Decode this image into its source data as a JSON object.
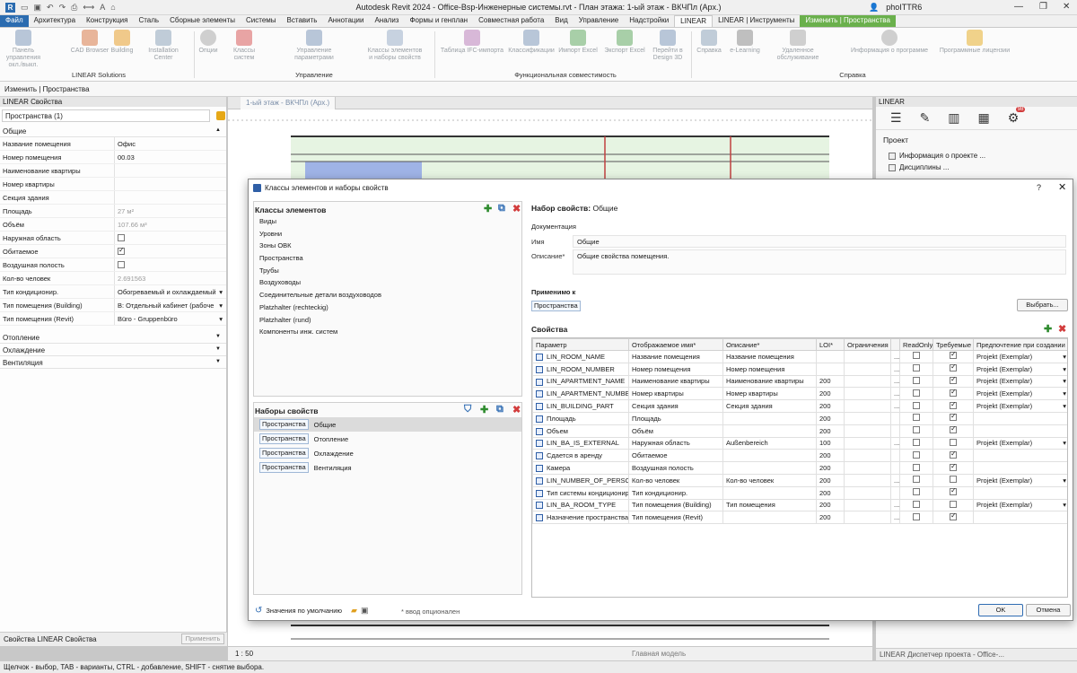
{
  "titlebar": {
    "title": "Autodesk Revit 2024 - Office-Bsp-Инженерные системы.rvt - План этажа: 1-ый этаж - ВКЧПл (Арх.)",
    "user": "phoITTR6",
    "minimize": "—",
    "restore": "❐",
    "close": "✕"
  },
  "menu": {
    "tabs": [
      "Файл",
      "Архитектура",
      "Конструкция",
      "Сталь",
      "Сборные элементы",
      "Системы",
      "Вставить",
      "Аннотации",
      "Анализ",
      "Формы и генплан",
      "Совместная работа",
      "Вид",
      "Управление",
      "Надстройки",
      "LINEAR",
      "LINEAR | Инструменты",
      "Изменить | Пространства"
    ]
  },
  "ribbon": {
    "buttons": [
      "Панель управления\nокл./выкл.",
      "CAD Browser",
      "Building",
      "Installation Center",
      "Опции",
      "Классы систем",
      "Управление параметрами",
      "Классы элементов\nи наборы свойств",
      "Таблица IFC-импорта",
      "Классификации",
      "Импорт Excel",
      "Экспорт Excel",
      "Перейти в\nDesign 3D",
      "Справка",
      "e-Learning",
      "Удаленное обслуживание",
      "Информация о программе",
      "Программные лицензии"
    ],
    "groups": [
      "LINEAR Solutions",
      "Управление",
      "Функциональная совместимость",
      "Справка"
    ]
  },
  "context_bar": "Изменить | Пространства",
  "properties": {
    "header": "LINEAR Свойства",
    "type_selector": "Пространства (1)",
    "sections": [
      "Общие",
      "Отопление",
      "Охлаждение",
      "Вентиляция"
    ],
    "rows": [
      {
        "k": "Название помещения",
        "v": "Офис"
      },
      {
        "k": "Номер помещения",
        "v": "00.03"
      },
      {
        "k": "Наименование квартиры",
        "v": ""
      },
      {
        "k": "Номер квартиры",
        "v": ""
      },
      {
        "k": "Секция здания",
        "v": ""
      },
      {
        "k": "Площадь",
        "v": "27 м²"
      },
      {
        "k": "Объём",
        "v": "107.66 м³"
      },
      {
        "k": "Наружная область",
        "v": ""
      },
      {
        "k": "Обитаемое",
        "v": ""
      },
      {
        "k": "Воздушная полость",
        "v": ""
      },
      {
        "k": "Кол-во человек",
        "v": "2.691563"
      },
      {
        "k": "Тип кондиционир.",
        "v": "Обогреваемый и охлаждаемый"
      },
      {
        "k": "Тип помещения (Building)",
        "v": "B: Отдельный кабинет (рабоче"
      },
      {
        "k": "Тип помещения (Revit)",
        "v": "Büro - Gruppenbüro"
      }
    ],
    "bottom_tabs": "Свойства    LINEAR Свойства",
    "apply": "Применить"
  },
  "view": {
    "tab": "1-ый этаж - ВКЧПл (Арх.)",
    "scale": "1 : 50",
    "model": "Главная модель"
  },
  "right_panel": {
    "header": "LINEAR",
    "badge": "98",
    "title": "Проект",
    "items": [
      "Информация о проекте ...",
      "Дисциплины ..."
    ],
    "bottom": "LINEAR    Диспетчер проекта - Office-..."
  },
  "status_bar": "Щелчок - выбор, TAB - варианты, CTRL - добавление, SHIFT - снятие выбора.",
  "dialog": {
    "title": "Классы элементов и наборы свойств",
    "help": "?",
    "close": "✕",
    "classes_title": "Классы элементов",
    "classes": [
      "Виды",
      "Уровни",
      "Зоны ОВК",
      "Пространства",
      "Трубы",
      "Воздуховоды",
      "Соединительные детали воздуховодов",
      "Platzhalter (rechteckig)",
      "Platzhalter (rund)",
      "Компоненты инж. систем"
    ],
    "sets_title": "Наборы свойств",
    "sets": [
      {
        "tag": "Пространства",
        "name": "Общие"
      },
      {
        "tag": "Пространства",
        "name": "Отопление"
      },
      {
        "tag": "Пространства",
        "name": "Охлаждение"
      },
      {
        "tag": "Пространства",
        "name": "Вентиляция"
      }
    ],
    "defaults": "Значения по умолчанию",
    "optional_note": "* ввод опционален",
    "set_label": "Набор свойств:",
    "set_name": "Общие",
    "doc_title": "Документация",
    "name_label": "Имя",
    "name_value": "Общие",
    "desc_label": "Описание*",
    "desc_value": "Общие свойства помещения.",
    "applies_title": "Применимо к",
    "applies_tag": "Пространства",
    "select_btn": "Выбрать...",
    "props_title": "Свойства",
    "columns": [
      "Параметр",
      "Отображаемое имя*",
      "Описание*",
      "LOI*",
      "Ограничения",
      "",
      "ReadOnly",
      "Требуемые",
      "Предпочтение при создании"
    ],
    "rows": [
      {
        "p": "LIN_ROOM_NAME",
        "d": "Название помещения",
        "desc": "Название помещения",
        "loi": "",
        "dots": "...",
        "ro": false,
        "req": true,
        "pref": "Projekt (Exemplar)"
      },
      {
        "p": "LIN_ROOM_NUMBER",
        "d": "Номер помещения",
        "desc": "Номер помещения",
        "loi": "",
        "dots": "...",
        "ro": false,
        "req": true,
        "pref": "Projekt (Exemplar)"
      },
      {
        "p": "LIN_APARTMENT_NAME",
        "d": "Наименование квартиры",
        "desc": "Наименование квартиры",
        "loi": "200",
        "dots": "...",
        "ro": false,
        "req": true,
        "pref": "Projekt (Exemplar)"
      },
      {
        "p": "LIN_APARTMENT_NUMBER",
        "d": "Номер квартиры",
        "desc": "Номер квартиры",
        "loi": "200",
        "dots": "...",
        "ro": false,
        "req": true,
        "pref": "Projekt (Exemplar)"
      },
      {
        "p": "LIN_BUILDING_PART",
        "d": "Секция здания",
        "desc": "Секция здания",
        "loi": "200",
        "dots": "...",
        "ro": false,
        "req": true,
        "pref": "Projekt (Exemplar)"
      },
      {
        "p": "Площадь",
        "d": "Площадь",
        "desc": "",
        "loi": "200",
        "dots": "",
        "ro": false,
        "req": true,
        "pref": ""
      },
      {
        "p": "Объем",
        "d": "Объём",
        "desc": "",
        "loi": "200",
        "dots": "",
        "ro": false,
        "req": true,
        "pref": ""
      },
      {
        "p": "LIN_BA_IS_EXTERNAL",
        "d": "Наружная область",
        "desc": "Außenbereich",
        "loi": "100",
        "dots": "...",
        "ro": false,
        "req": false,
        "pref": "Projekt (Exemplar)"
      },
      {
        "p": "Сдается в аренду",
        "d": "Обитаемое",
        "desc": "",
        "loi": "200",
        "dots": "",
        "ro": false,
        "req": true,
        "pref": ""
      },
      {
        "p": "Камера",
        "d": "Воздушная полость",
        "desc": "",
        "loi": "200",
        "dots": "",
        "ro": false,
        "req": true,
        "pref": ""
      },
      {
        "p": "LIN_NUMBER_OF_PERSONS",
        "d": "Кол-во человек",
        "desc": "Кол-во человек",
        "loi": "200",
        "dots": "...",
        "ro": false,
        "req": false,
        "pref": "Projekt (Exemplar)"
      },
      {
        "p": "Тип системы кондиционир.",
        "d": "Тип кондиционир.",
        "desc": "",
        "loi": "200",
        "dots": "",
        "ro": false,
        "req": true,
        "pref": ""
      },
      {
        "p": "LIN_BA_ROOM_TYPE",
        "d": "Тип помещения (Building)",
        "desc": "Тип помещения",
        "loi": "200",
        "dots": "...",
        "ro": false,
        "req": false,
        "pref": "Projekt (Exemplar)"
      },
      {
        "p": "Назначение пространства",
        "d": "Тип помещения (Revit)",
        "desc": "",
        "loi": "200",
        "dots": "...",
        "ro": false,
        "req": true,
        "pref": ""
      }
    ],
    "ok": "OK",
    "cancel": "Отмена"
  }
}
